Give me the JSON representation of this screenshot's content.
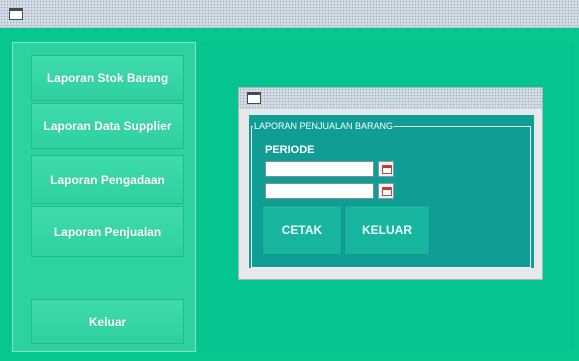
{
  "sidebar": {
    "buttons": [
      {
        "label": "Laporan Stok Barang"
      },
      {
        "label": "Laporan Data Supplier"
      },
      {
        "label": "Laporan  Pengadaan"
      },
      {
        "label": "Laporan Penjualan"
      },
      {
        "label": "Keluar"
      }
    ]
  },
  "dialog": {
    "group_title": "LAPORAN PENJUALAN BARANG",
    "periode_label": "PERIODE",
    "date_from": "",
    "date_to": "",
    "cetak_label": "CETAK",
    "keluar_label": "KELUAR"
  },
  "icons": {
    "window": "window-icon",
    "calendar": "calendar-icon"
  },
  "colors": {
    "background": "#08c68f",
    "sidebar": "#2ed2a1",
    "dialog_panel": "#109d96"
  }
}
